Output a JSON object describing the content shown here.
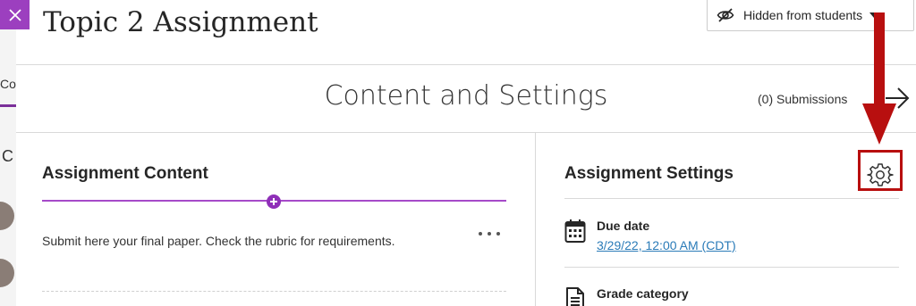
{
  "background": {
    "tab_text": "Co",
    "letter": "C"
  },
  "panel": {
    "close_icon": "close-icon",
    "title": "Topic 2 Assignment",
    "visibility": {
      "icon": "eye-slash-icon",
      "label": "Hidden from students"
    },
    "subheader": {
      "title": "Content and Settings",
      "submissions": "(0) Submissions",
      "next_icon": "arrow-right-icon"
    },
    "content": {
      "heading": "Assignment Content",
      "add_icon": "plus-circle-icon",
      "text": "Submit here your final paper. Check the rubric for requirements.",
      "more_icon": "ellipsis-icon"
    },
    "settings": {
      "heading": "Assignment Settings",
      "gear_icon": "gear-icon",
      "due_date": {
        "icon": "calendar-icon",
        "label": "Due date",
        "value": "3/29/22, 12:00 AM (CDT)"
      },
      "grade_category": {
        "icon": "document-icon",
        "label": "Grade category"
      }
    }
  },
  "colors": {
    "accent_purple": "#a64ac9",
    "annotation_red": "#b80f0f",
    "link_blue": "#2a7bb8"
  }
}
